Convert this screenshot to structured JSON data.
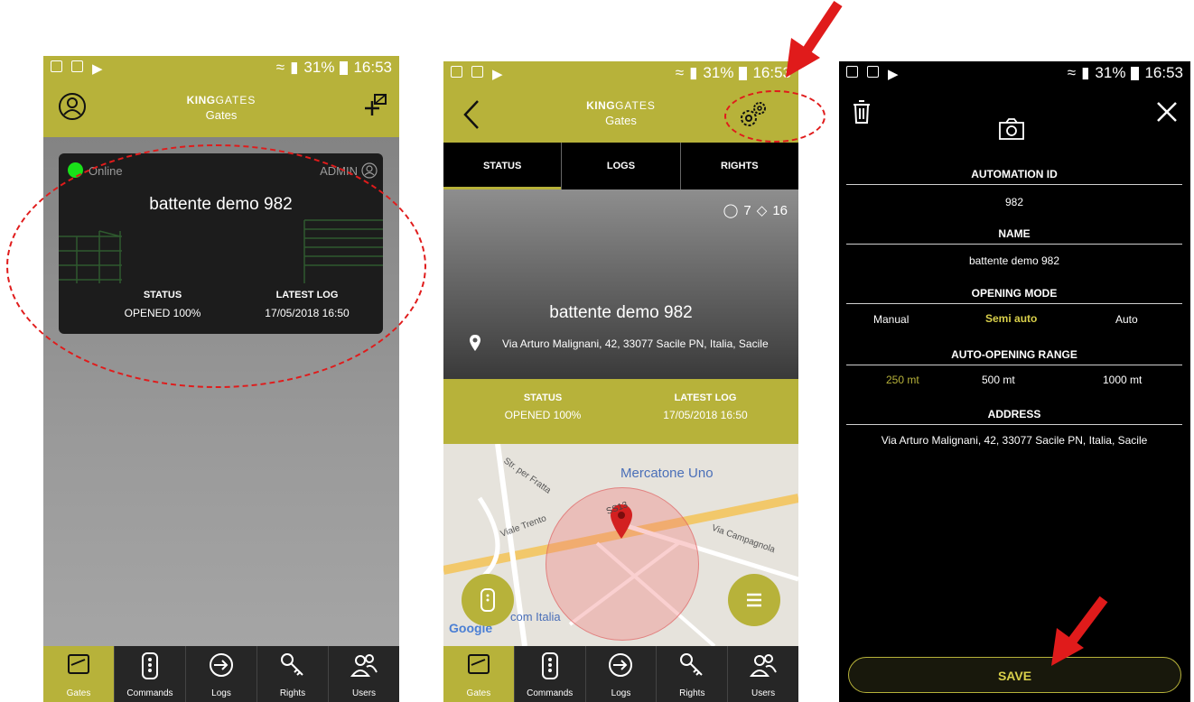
{
  "status_bar": {
    "battery": "31%",
    "time": "16:53"
  },
  "brand": {
    "bold": "KING",
    "thin": "GATES"
  },
  "screen1": {
    "title": "Gates",
    "gate": {
      "online": "Online",
      "role": "ADMIN",
      "name": "battente demo 982",
      "status_label": "STATUS",
      "status_value": "OPENED 100%",
      "log_label": "LATEST LOG",
      "log_value": "17/05/2018 16:50"
    }
  },
  "screen2": {
    "title": "Gates",
    "tabs": [
      "STATUS",
      "LOGS",
      "RIGHTS"
    ],
    "users_count": "7",
    "tags_count": "16",
    "name": "battente demo 982",
    "address": "Via Arturo Malignani, 42, 33077 Sacile PN, Italia, Sacile",
    "status_label": "STATUS",
    "status_value": "OPENED 100%",
    "log_label": "LATEST LOG",
    "log_value": "17/05/2018 16:50",
    "map": {
      "poi": "Mercatone Uno",
      "street1": "Str. per Fratta",
      "road": "SS13",
      "street2": "Viale Trento",
      "street3": "Via Campagnola",
      "poi2": "com Italia",
      "google": "Google"
    }
  },
  "screen3": {
    "automation_id_label": "AUTOMATION ID",
    "automation_id": "982",
    "name_label": "NAME",
    "name": "battente demo 982",
    "opening_mode_label": "OPENING MODE",
    "modes": [
      "Manual",
      "Semi auto",
      "Auto"
    ],
    "range_label": "AUTO-OPENING RANGE",
    "ranges": [
      "250 mt",
      "500 mt",
      "1000 mt"
    ],
    "address_label": "ADDRESS",
    "address": "Via Arturo Malignani, 42, 33077 Sacile PN, Italia, Sacile",
    "save": "SAVE"
  },
  "nav": [
    "Gates",
    "Commands",
    "Logs",
    "Rights",
    "Users"
  ],
  "colors": {
    "accent": "#b7b23a",
    "online": "#19e019",
    "annotation": "#e01b1b"
  }
}
